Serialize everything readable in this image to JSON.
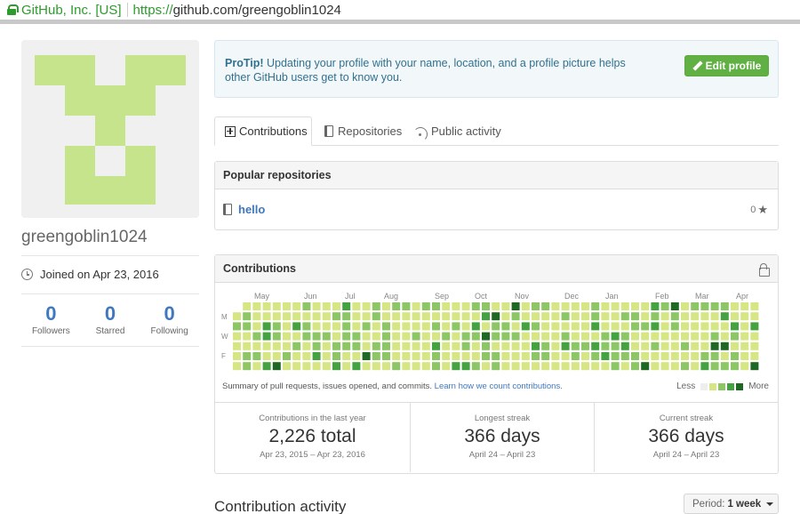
{
  "browser": {
    "security_label": "GitHub, Inc. [US]",
    "url_scheme": "https://",
    "url_rest": "github.com/greengoblin1024"
  },
  "profile": {
    "username": "greengoblin1024",
    "joined": "Joined on Apr 23, 2016",
    "stats": [
      {
        "value": "0",
        "label": "Followers"
      },
      {
        "value": "0",
        "label": "Starred"
      },
      {
        "value": "0",
        "label": "Following"
      }
    ]
  },
  "protip": {
    "lead": "ProTip!",
    "text": " Updating your profile with your name, location, and a profile picture helps other GitHub users get to know you.",
    "edit_button": "Edit profile"
  },
  "tabs": [
    {
      "label": "Contributions"
    },
    {
      "label": "Repositories"
    },
    {
      "label": "Public activity"
    }
  ],
  "popular_repos": {
    "title": "Popular repositories",
    "items": [
      {
        "name": "hello",
        "stars": "0"
      }
    ]
  },
  "contributions": {
    "title": "Contributions",
    "months": [
      "May",
      "Jun",
      "Jul",
      "Aug",
      "Sep",
      "Oct",
      "Nov",
      "Dec",
      "Jan",
      "Feb",
      "Mar",
      "Apr"
    ],
    "day_labels": [
      "M",
      "W",
      "F"
    ],
    "summary": "Summary of pull requests, issues opened, and commits.",
    "summary_link": "Learn how we count contributions.",
    "legend_less": "Less",
    "legend_more": "More",
    "colors": [
      "#eeeeee",
      "#d6e685",
      "#8cc665",
      "#44a340",
      "#1e6823"
    ],
    "totals": [
      {
        "label": "Contributions in the last year",
        "value": "2,226 total",
        "range": "Apr 23, 2015 – Apr 23, 2016"
      },
      {
        "label": "Longest streak",
        "value": "366 days",
        "range": "April 24 – April 23"
      },
      {
        "label": "Current streak",
        "value": "366 days",
        "range": "April 24 – April 23"
      }
    ]
  },
  "activity": {
    "title": "Contribution activity",
    "period_label": "Period:",
    "period_value": "1 week"
  }
}
